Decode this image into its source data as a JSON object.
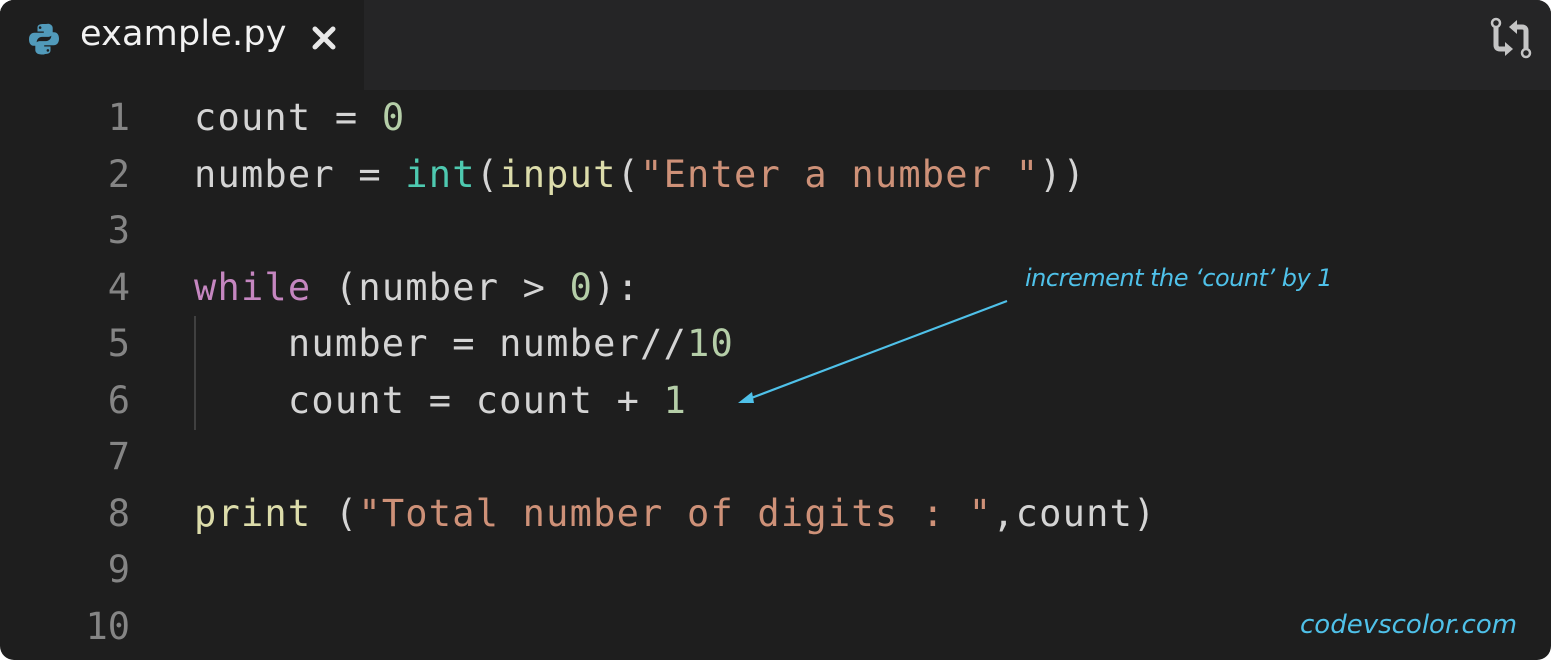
{
  "tab": {
    "title": "example.py",
    "icon": "python-icon",
    "close_icon": "close-icon"
  },
  "toolbar": {
    "compare_icon": "git-compare-icon"
  },
  "editor": {
    "line_numbers": [
      "1",
      "2",
      "3",
      "4",
      "5",
      "6",
      "7",
      "8",
      "9",
      "10"
    ],
    "lines": [
      [
        {
          "t": "txt",
          "v": "count = "
        },
        {
          "t": "num",
          "v": "0"
        }
      ],
      [
        {
          "t": "txt",
          "v": "number = "
        },
        {
          "t": "bi",
          "v": "int"
        },
        {
          "t": "txt",
          "v": "("
        },
        {
          "t": "fn",
          "v": "input"
        },
        {
          "t": "txt",
          "v": "("
        },
        {
          "t": "str",
          "v": "\"Enter a number \""
        },
        {
          "t": "txt",
          "v": "))"
        }
      ],
      [],
      [
        {
          "t": "kw",
          "v": "while"
        },
        {
          "t": "txt",
          "v": " (number > "
        },
        {
          "t": "num",
          "v": "0"
        },
        {
          "t": "txt",
          "v": "):"
        }
      ],
      [
        {
          "t": "txt",
          "v": "    number = number//"
        },
        {
          "t": "num",
          "v": "10"
        }
      ],
      [
        {
          "t": "txt",
          "v": "    count = count + "
        },
        {
          "t": "num",
          "v": "1"
        }
      ],
      [],
      [
        {
          "t": "fn",
          "v": "print"
        },
        {
          "t": "txt",
          "v": " ("
        },
        {
          "t": "str",
          "v": "\"Total number of digits : \""
        },
        {
          "t": "txt",
          "v": ",count)"
        }
      ],
      [],
      []
    ]
  },
  "annotation": {
    "text": "increment the ‘count’ by 1",
    "color": "#4fc1e9"
  },
  "watermark": {
    "text": "codevscolor.com"
  },
  "colors": {
    "background": "#1e1e1e",
    "tabbar": "#252526",
    "keyword": "#c586c0",
    "function": "#dcdcaa",
    "builtin": "#4ec9b0",
    "string": "#ce9178",
    "number": "#b5cea8",
    "text": "#d4d4d4",
    "line_number": "#858585"
  }
}
